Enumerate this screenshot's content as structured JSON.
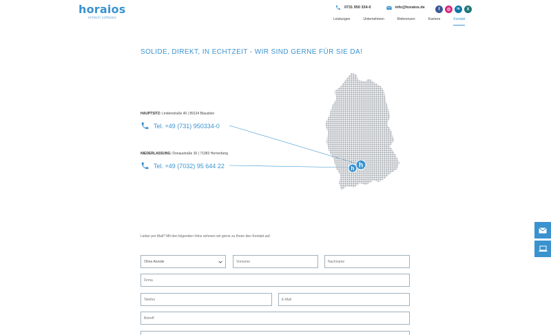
{
  "brand": {
    "name": "horaios",
    "tagline": "einfach software"
  },
  "header": {
    "phone": "0731 950 334-0",
    "email": "info@horaios.de",
    "social": [
      {
        "icon": "facebook-icon",
        "glyph": "f",
        "color": "#3b5998"
      },
      {
        "icon": "instagram-icon",
        "glyph": "◎",
        "color": "#d6297a"
      },
      {
        "icon": "linkedin-icon",
        "glyph": "in",
        "color": "#0e76a8"
      },
      {
        "icon": "xing-icon",
        "glyph": "X",
        "color": "#1a7576"
      }
    ]
  },
  "nav": {
    "items": [
      "Leistungen",
      "Unternehmen",
      "Referenzen",
      "Karriere",
      "Kontakt"
    ],
    "active": "Kontakt"
  },
  "headline": "SOLIDE, DIREKT, IN ECHTZEIT - WIR SIND GERNE FÜR SIE DA!",
  "locations": [
    {
      "label": "HAUPTSITZ:",
      "address": "Lindenstraße 40 | 89134 Blaustein",
      "phone": "Tel. +49 (731) 950334-0"
    },
    {
      "label": "NIEDERLASSUNG:",
      "address": "Donaustraße 30 | 71083 Herrenberg",
      "phone": "Tel. +49 (7032) 95 644 22"
    }
  ],
  "map": {
    "marker_glyph": "h"
  },
  "form": {
    "intro": "Lieber per Mail? Mit den folgenden Infos nehmen wir gerne zu Ihnen den Kontakt auf.",
    "salutation": "Ohne Anrede",
    "firstname": "Vorname",
    "lastname": "Nachname",
    "company": "Firma",
    "phone": "Telefon",
    "email": "E-Mail",
    "subject": "Betreff"
  },
  "colors": {
    "accent": "#3a92cf",
    "map_dots": "#9aa0a6",
    "text": "#444444"
  }
}
